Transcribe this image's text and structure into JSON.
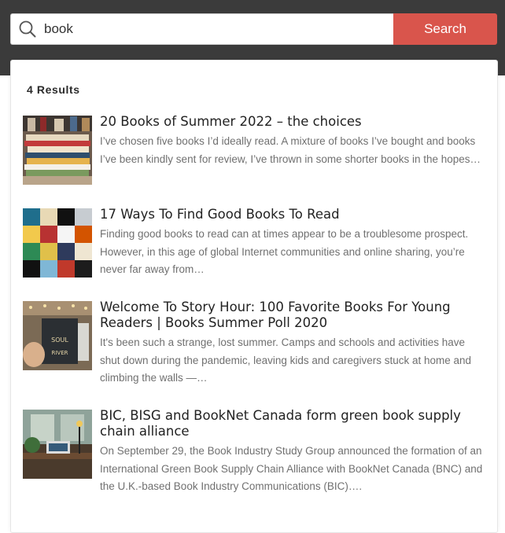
{
  "search": {
    "value": "book",
    "button_label": "Search"
  },
  "results": {
    "count_label": "4 Results",
    "items": [
      {
        "title": "20 Books of Summer 2022 – the choices",
        "excerpt": "I’ve chosen five books I’d ideally read. A mixture of books I’ve bought and books I’ve been kindly sent for review, I’ve thrown in some shorter books in the hopes…"
      },
      {
        "title": "17 Ways To Find Good Books To Read",
        "excerpt": "Finding good books to read can at times appear to be a troublesome prospect. However, in this age of global Internet communities and online sharing, you’re never far away from…"
      },
      {
        "title": "Welcome To Story Hour: 100 Favorite Books For Young Readers | Books Summer Poll 2020",
        "excerpt": "It's been such a strange, lost summer. Camps and schools and activities have shut down during the pandemic, leaving kids and caregivers stuck at home and climbing the walls —…"
      },
      {
        "title": "BIC, BISG and BookNet Canada form green book supply chain alliance",
        "excerpt": "On September 29, the Book Industry Study Group announced the formation of an International Green Book Supply Chain Alliance with BookNet Canada (BNC) and the U.K.-based Book Industry Communications (BIC)…."
      }
    ]
  },
  "thumb_text": {
    "book_cover_soul": "SOUL",
    "book_cover_river": "RIVER"
  },
  "colors": {
    "header_bg": "#3b3b3b",
    "search_button": "#d9554c"
  }
}
